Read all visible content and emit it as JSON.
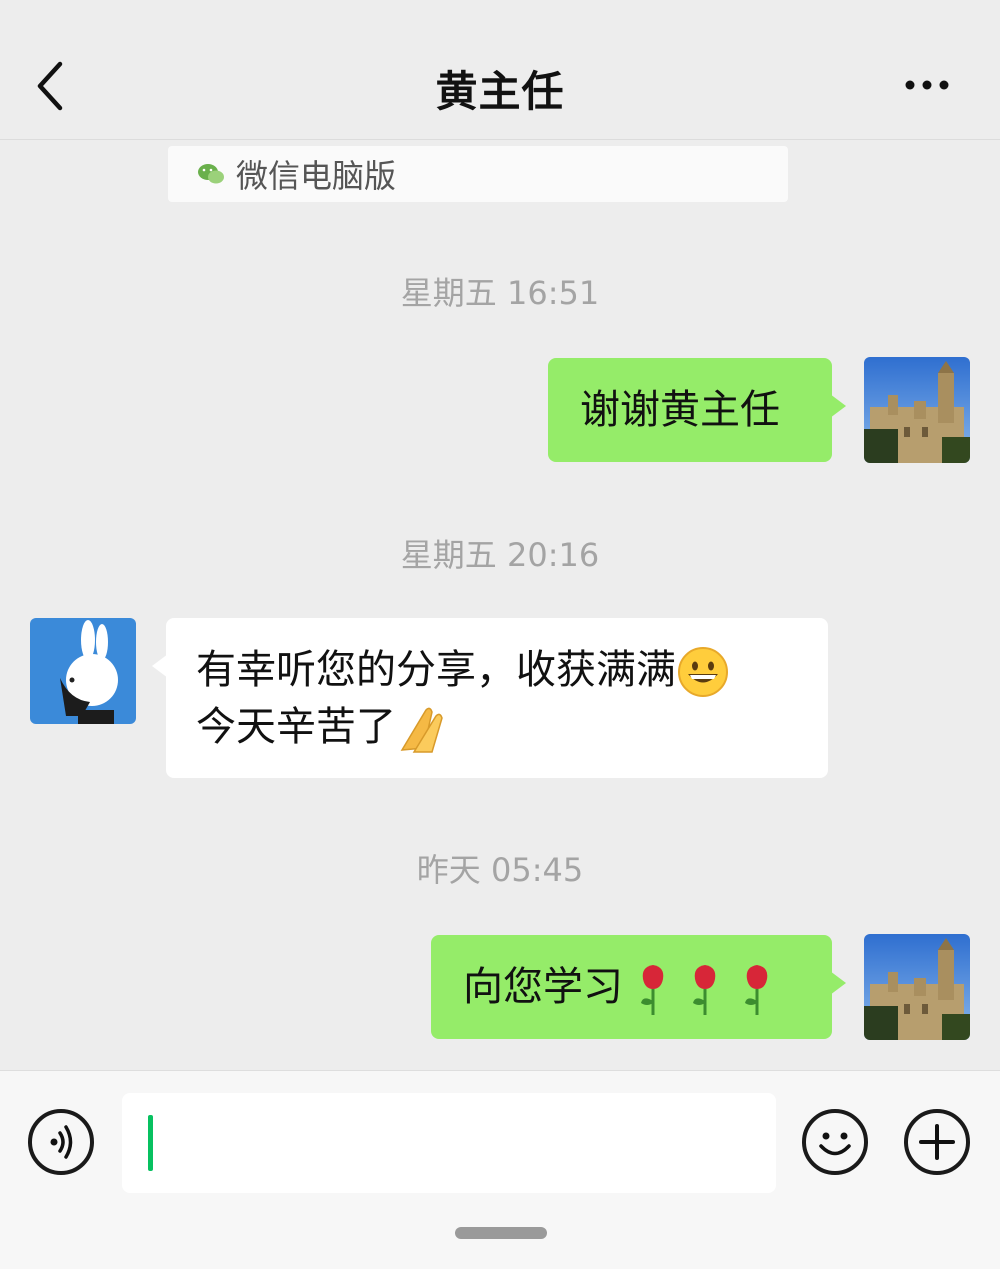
{
  "header": {
    "title": "黄主任",
    "back_icon": "chevron-left-icon",
    "more_icon": "more-dots-icon"
  },
  "quote_card": {
    "text": "微信电脑版",
    "icon": "wechat-icon"
  },
  "messages": [
    {
      "timestamp": "星期五 16:51",
      "sender": "me",
      "text": "谢谢黄主任"
    },
    {
      "timestamp": "星期五 20:16",
      "sender": "other",
      "line1": "有幸听您的分享，收获满满",
      "line2": "今天辛苦了",
      "emoji1": "grinning-face-icon",
      "emoji2": "folded-hands-icon"
    },
    {
      "timestamp": "昨天 05:45",
      "sender": "me",
      "text": "向您学习",
      "emoji": "rose-icon",
      "emoji_count": 3
    }
  ],
  "input_bar": {
    "voice_icon": "voice-icon",
    "emoji_icon": "emoji-icon",
    "plus_icon": "plus-icon",
    "value": ""
  },
  "colors": {
    "background": "#ededed",
    "my_bubble": "#95ec69",
    "other_bubble": "#ffffff",
    "caret": "#07c160",
    "timestamp": "#a4a4a4"
  }
}
